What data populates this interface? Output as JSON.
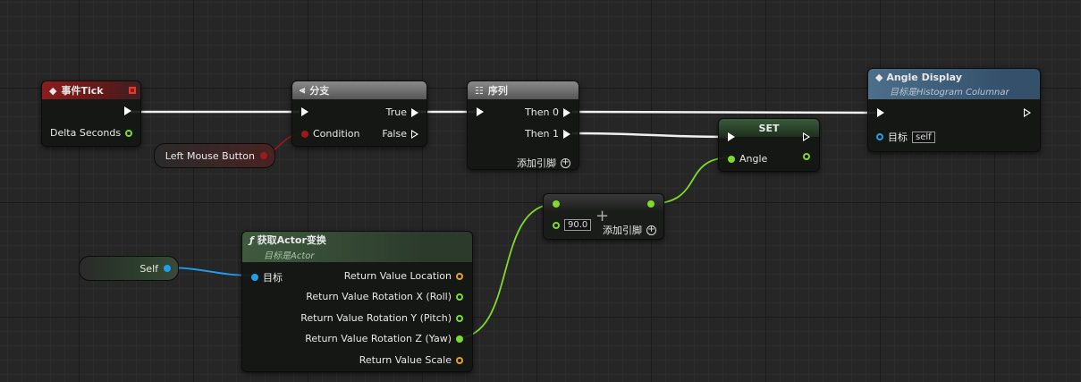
{
  "nodes": {
    "event_tick": {
      "title": "事件Tick",
      "delta_seconds": "Delta Seconds"
    },
    "branch": {
      "title": "分支",
      "condition": "Condition",
      "true_label": "True",
      "false_label": "False"
    },
    "sequence": {
      "title": "序列",
      "then0": "Then 0",
      "then1": "Then 1",
      "add_pin": "添加引脚"
    },
    "angle_display": {
      "title": "Angle Display",
      "subtitle": "目标是Histogram Columnar",
      "target": "目标",
      "target_value": "self"
    },
    "set": {
      "title": "SET",
      "angle": "Angle"
    },
    "add": {
      "value": "90.0",
      "add_pin": "添加引脚"
    },
    "get_actor_transform": {
      "title": "获取Actor变换",
      "subtitle": "目标是Actor",
      "target": "目标",
      "outputs": [
        "Return Value Location",
        "Return Value Rotation X (Roll)",
        "Return Value Rotation Y (Pitch)",
        "Return Value Rotation Z (Yaw)",
        "Return Value Scale"
      ]
    },
    "left_mouse_button": {
      "label": "Left Mouse Button"
    },
    "self_ref": {
      "label": "Self"
    }
  },
  "icons": {
    "event": "diamond-icon",
    "branch": "branch-icon",
    "sequence": "sequence-icon",
    "function": "function-icon",
    "add": "plus-icon"
  },
  "colors": {
    "exec": "#ffffff",
    "float": "#7ddc2a",
    "bool": "#a01818",
    "object": "#1ea0f0",
    "struct": "#e8a020"
  }
}
